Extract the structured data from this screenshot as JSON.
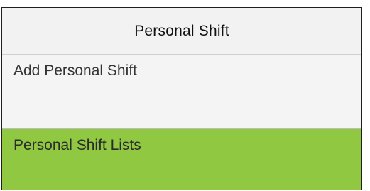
{
  "header": {
    "title": "Personal Shift"
  },
  "menu": {
    "items": [
      {
        "label": "Add Personal Shift",
        "selected": false
      },
      {
        "label": "Personal Shift Lists",
        "selected": true
      }
    ]
  },
  "colors": {
    "selected_background": "#90c842",
    "background": "#f3f3f3"
  }
}
